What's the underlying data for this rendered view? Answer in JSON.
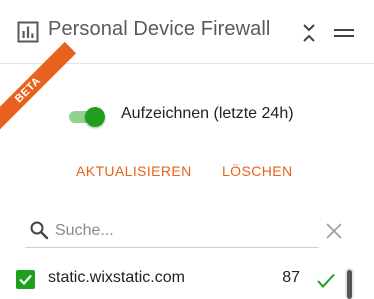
{
  "header": {
    "title": "Personal Device Firewall",
    "app_icon": "bar-chart-icon",
    "collapse_icon": "chevrons-collapse-icon",
    "menu_icon": "menu-icon"
  },
  "beta": {
    "label": "BETA"
  },
  "recording": {
    "label": "Aufzeichnen (letzte 24h)",
    "enabled": true
  },
  "actions": {
    "refresh_label": "AKTUALISIEREN",
    "clear_label": "LÖSCHEN"
  },
  "search": {
    "placeholder": "Suche...",
    "value": ""
  },
  "list": {
    "items": [
      {
        "domain": "static.wixstatic.com",
        "count": "87",
        "checked": true,
        "status": "allowed"
      }
    ]
  },
  "colors": {
    "accent": "#e8621d",
    "green": "#1ea01e",
    "toggle_track": "#8fd38d"
  }
}
